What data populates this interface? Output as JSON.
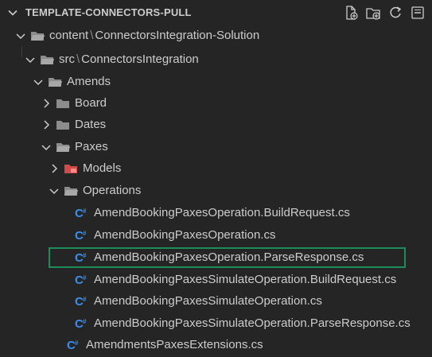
{
  "header": {
    "title": "TEMPLATE-CONNECTORS-PULL",
    "actions": [
      "new-file-icon",
      "new-folder-icon",
      "refresh-icon",
      "collapse-all-icon"
    ]
  },
  "colors": {
    "background": "#252526",
    "text": "#cccccc",
    "folder": "#8c8c8c",
    "models_folder": "#e05555",
    "csharp": "#3b8eea",
    "highlight_border": "#1e8c5a"
  },
  "tree": {
    "root_parts": [
      "content",
      "ConnectorsIntegration-Solution"
    ],
    "src_parts": [
      "src",
      "ConnectorsIntegration"
    ],
    "separator": "\\",
    "amends": "Amends",
    "board": "Board",
    "dates": "Dates",
    "paxes": "Paxes",
    "models": "Models",
    "operations": "Operations",
    "files": [
      "AmendBookingPaxesOperation.BuildRequest.cs",
      "AmendBookingPaxesOperation.cs",
      "AmendBookingPaxesOperation.ParseResponse.cs",
      "AmendBookingPaxesSimulateOperation.BuildRequest.cs",
      "AmendBookingPaxesSimulateOperation.cs",
      "AmendBookingPaxesSimulateOperation.ParseResponse.cs"
    ],
    "extensions_file": "AmendmentsPaxesExtensions.cs"
  }
}
